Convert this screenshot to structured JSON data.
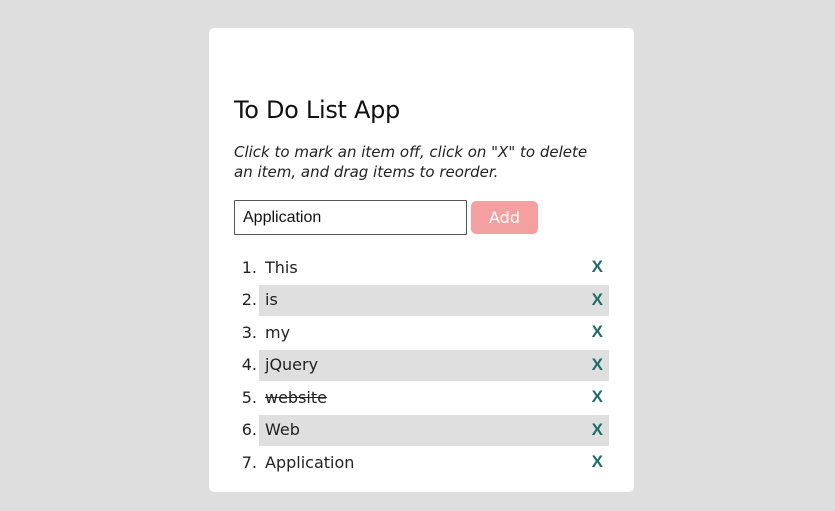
{
  "app": {
    "title": "To Do List App",
    "instructions": "Click to mark an item off, click on \"X\" to delete an item, and drag items to reorder."
  },
  "form": {
    "input_value": "Application",
    "add_label": "Add"
  },
  "colors": {
    "page_bg": "#dedede",
    "card_bg": "#ffffff",
    "add_button": "#f4a0a0",
    "delete_x": "#1e6b6b",
    "alt_row": "#dfdfdf"
  },
  "todos": [
    {
      "num": "1.",
      "text": "This",
      "done": false,
      "delete": "X"
    },
    {
      "num": "2.",
      "text": "is",
      "done": false,
      "delete": "X"
    },
    {
      "num": "3.",
      "text": "my",
      "done": false,
      "delete": "X"
    },
    {
      "num": "4.",
      "text": "jQuery",
      "done": false,
      "delete": "X"
    },
    {
      "num": "5.",
      "text": "website",
      "done": true,
      "delete": "X"
    },
    {
      "num": "6.",
      "text": "Web",
      "done": false,
      "delete": "X"
    },
    {
      "num": "7.",
      "text": "Application",
      "done": false,
      "delete": "X"
    }
  ]
}
